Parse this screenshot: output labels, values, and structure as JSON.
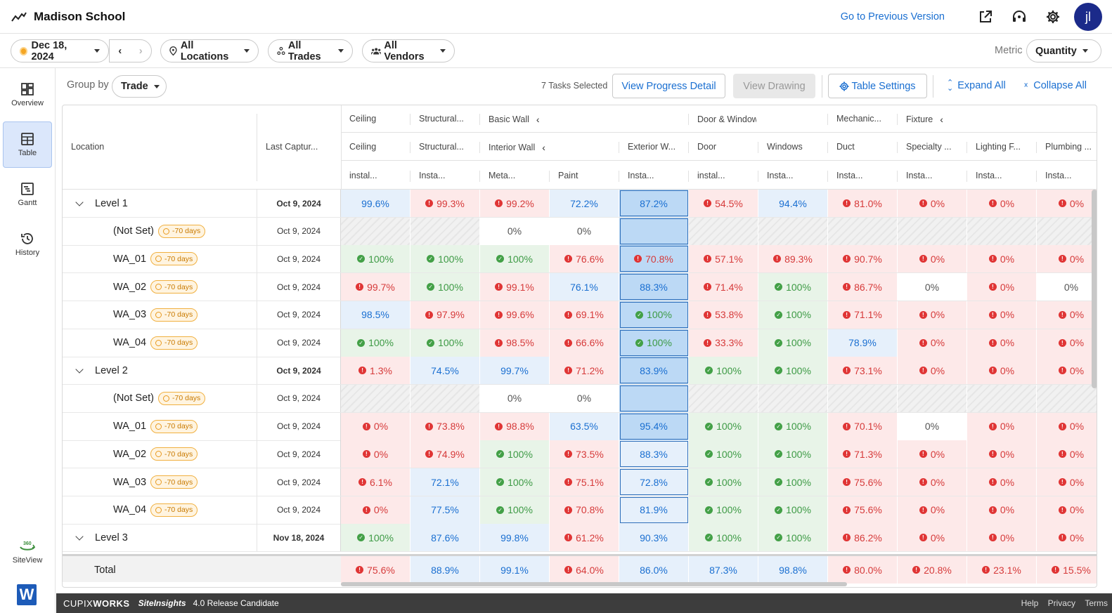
{
  "app": {
    "title": "Madison School",
    "prev_version": "Go to Previous Version",
    "avatar": "jl"
  },
  "filters": {
    "date": "Dec 18, 2024",
    "locations": "All Locations",
    "trades": "All Trades",
    "vendors": "All Vendors",
    "metric_label": "Metric",
    "metric_value": "Quantity"
  },
  "sidebar": {
    "items": [
      {
        "label": "Overview"
      },
      {
        "label": "Table"
      },
      {
        "label": "Gantt"
      },
      {
        "label": "History"
      }
    ],
    "siteview": "SiteView"
  },
  "toolbar": {
    "group_by_label": "Group by",
    "group_by_value": "Trade",
    "tasks_selected": "7 Tasks Selected",
    "view_progress": "View Progress Detail",
    "view_drawing": "View Drawing",
    "table_settings": "Table Settings",
    "expand_all": "Expand All",
    "collapse_all": "Collapse All"
  },
  "table": {
    "location_header": "Location",
    "last_capture_header": "Last Captur...",
    "groups": [
      "Ceiling",
      "Structural...",
      "Basic Wall",
      "Door & Window",
      "Mechanic...",
      "Fixture"
    ],
    "subgroups": [
      "Ceiling",
      "Structural...",
      "Interior Wall",
      "Exterior W...",
      "Door",
      "Windows",
      "Duct",
      "Specialty ...",
      "Lighting F...",
      "Plumbing ..."
    ],
    "tasks": [
      "instal...",
      "Insta...",
      "Meta...",
      "Paint",
      "Insta...",
      "instal...",
      "Insta...",
      "Insta...",
      "Insta...",
      "Insta...",
      "Insta..."
    ],
    "rows": [
      {
        "label": "Level 1",
        "level": 0,
        "date": "Oct 9, 2024",
        "cells": [
          [
            "99.6%",
            "b"
          ],
          [
            "99.3%",
            "r"
          ],
          [
            "99.2%",
            "r"
          ],
          [
            "72.2%",
            "b"
          ],
          [
            "87.2%",
            "s"
          ],
          [
            "54.5%",
            "r"
          ],
          [
            "94.4%",
            "b"
          ],
          [
            "81.0%",
            "r"
          ],
          [
            "0%",
            "r"
          ],
          [
            "0%",
            "r"
          ],
          [
            "0%",
            "r"
          ]
        ]
      },
      {
        "label": "(Not Set)",
        "level": 1,
        "badge": "-70 days",
        "date": "Oct 9, 2024",
        "cells": [
          [
            "",
            "h"
          ],
          [
            "",
            "h"
          ],
          [
            "0%",
            "w"
          ],
          [
            "0%",
            "w"
          ],
          [
            "",
            "hs"
          ],
          [
            "",
            "h"
          ],
          [
            "",
            "h"
          ],
          [
            "",
            "h"
          ],
          [
            "",
            "h"
          ],
          [
            "",
            "h"
          ],
          [
            "",
            "h"
          ]
        ]
      },
      {
        "label": "WA_01",
        "level": 1,
        "badge": "-70 days",
        "date": "Oct 9, 2024",
        "cells": [
          [
            "100%",
            "g"
          ],
          [
            "100%",
            "g"
          ],
          [
            "100%",
            "g"
          ],
          [
            "76.6%",
            "r"
          ],
          [
            "70.8%",
            "rs"
          ],
          [
            "57.1%",
            "r"
          ],
          [
            "89.3%",
            "r"
          ],
          [
            "90.7%",
            "r"
          ],
          [
            "0%",
            "r"
          ],
          [
            "0%",
            "r"
          ],
          [
            "0%",
            "r"
          ]
        ]
      },
      {
        "label": "WA_02",
        "level": 1,
        "badge": "-70 days",
        "date": "Oct 9, 2024",
        "cells": [
          [
            "99.7%",
            "r"
          ],
          [
            "100%",
            "g"
          ],
          [
            "99.1%",
            "r"
          ],
          [
            "76.1%",
            "b"
          ],
          [
            "88.3%",
            "s"
          ],
          [
            "71.4%",
            "r"
          ],
          [
            "100%",
            "g"
          ],
          [
            "86.7%",
            "r"
          ],
          [
            "0%",
            "w"
          ],
          [
            "0%",
            "r"
          ],
          [
            "0%",
            "w"
          ]
        ]
      },
      {
        "label": "WA_03",
        "level": 1,
        "badge": "-70 days",
        "date": "Oct 9, 2024",
        "cells": [
          [
            "98.5%",
            "b"
          ],
          [
            "97.9%",
            "r"
          ],
          [
            "99.6%",
            "r"
          ],
          [
            "69.1%",
            "r"
          ],
          [
            "100%",
            "gs"
          ],
          [
            "53.8%",
            "r"
          ],
          [
            "100%",
            "g"
          ],
          [
            "71.1%",
            "r"
          ],
          [
            "0%",
            "r"
          ],
          [
            "0%",
            "r"
          ],
          [
            "0%",
            "r"
          ]
        ]
      },
      {
        "label": "WA_04",
        "level": 1,
        "badge": "-70 days",
        "date": "Oct 9, 2024",
        "cells": [
          [
            "100%",
            "g"
          ],
          [
            "100%",
            "g"
          ],
          [
            "98.5%",
            "r"
          ],
          [
            "66.6%",
            "r"
          ],
          [
            "100%",
            "gs"
          ],
          [
            "33.3%",
            "r"
          ],
          [
            "100%",
            "g"
          ],
          [
            "78.9%",
            "b"
          ],
          [
            "0%",
            "r"
          ],
          [
            "0%",
            "r"
          ],
          [
            "0%",
            "r"
          ]
        ]
      },
      {
        "label": "Level 2",
        "level": 0,
        "date": "Oct 9, 2024",
        "cells": [
          [
            "1.3%",
            "r"
          ],
          [
            "74.5%",
            "b"
          ],
          [
            "99.7%",
            "b"
          ],
          [
            "71.2%",
            "r"
          ],
          [
            "83.9%",
            "s"
          ],
          [
            "100%",
            "g"
          ],
          [
            "100%",
            "g"
          ],
          [
            "73.1%",
            "r"
          ],
          [
            "0%",
            "r"
          ],
          [
            "0%",
            "r"
          ],
          [
            "0%",
            "r"
          ]
        ]
      },
      {
        "label": "(Not Set)",
        "level": 1,
        "badge": "-70 days",
        "date": "Oct 9, 2024",
        "cells": [
          [
            "",
            "h"
          ],
          [
            "",
            "h"
          ],
          [
            "0%",
            "w"
          ],
          [
            "0%",
            "w"
          ],
          [
            "",
            "hs"
          ],
          [
            "",
            "h"
          ],
          [
            "",
            "h"
          ],
          [
            "",
            "h"
          ],
          [
            "",
            "h"
          ],
          [
            "",
            "h"
          ],
          [
            "",
            "h"
          ]
        ]
      },
      {
        "label": "WA_01",
        "level": 1,
        "badge": "-70 days",
        "date": "Oct 9, 2024",
        "cells": [
          [
            "0%",
            "r"
          ],
          [
            "73.8%",
            "r"
          ],
          [
            "98.8%",
            "r"
          ],
          [
            "63.5%",
            "b"
          ],
          [
            "95.4%",
            "s"
          ],
          [
            "100%",
            "g"
          ],
          [
            "100%",
            "g"
          ],
          [
            "70.1%",
            "r"
          ],
          [
            "0%",
            "w"
          ],
          [
            "0%",
            "r"
          ],
          [
            "0%",
            "r"
          ]
        ]
      },
      {
        "label": "WA_02",
        "level": 1,
        "badge": "-70 days",
        "date": "Oct 9, 2024",
        "cells": [
          [
            "0%",
            "r"
          ],
          [
            "74.9%",
            "r"
          ],
          [
            "100%",
            "g"
          ],
          [
            "73.5%",
            "r"
          ],
          [
            "88.3%",
            "bo"
          ],
          [
            "100%",
            "g"
          ],
          [
            "100%",
            "g"
          ],
          [
            "71.3%",
            "r"
          ],
          [
            "0%",
            "r"
          ],
          [
            "0%",
            "r"
          ],
          [
            "0%",
            "r"
          ]
        ]
      },
      {
        "label": "WA_03",
        "level": 1,
        "badge": "-70 days",
        "date": "Oct 9, 2024",
        "cells": [
          [
            "6.1%",
            "r"
          ],
          [
            "72.1%",
            "b"
          ],
          [
            "100%",
            "g"
          ],
          [
            "75.1%",
            "r"
          ],
          [
            "72.8%",
            "bo"
          ],
          [
            "100%",
            "g"
          ],
          [
            "100%",
            "g"
          ],
          [
            "75.6%",
            "r"
          ],
          [
            "0%",
            "r"
          ],
          [
            "0%",
            "r"
          ],
          [
            "0%",
            "r"
          ]
        ]
      },
      {
        "label": "WA_04",
        "level": 1,
        "badge": "-70 days",
        "date": "Oct 9, 2024",
        "cells": [
          [
            "0%",
            "r"
          ],
          [
            "77.5%",
            "b"
          ],
          [
            "100%",
            "g"
          ],
          [
            "70.8%",
            "r"
          ],
          [
            "81.9%",
            "bo"
          ],
          [
            "100%",
            "g"
          ],
          [
            "100%",
            "g"
          ],
          [
            "75.6%",
            "r"
          ],
          [
            "0%",
            "r"
          ],
          [
            "0%",
            "r"
          ],
          [
            "0%",
            "r"
          ]
        ]
      },
      {
        "label": "Level 3",
        "level": 0,
        "date": "Nov 18, 2024",
        "cells": [
          [
            "100%",
            "g"
          ],
          [
            "87.6%",
            "b"
          ],
          [
            "99.8%",
            "b"
          ],
          [
            "61.2%",
            "r"
          ],
          [
            "90.3%",
            "b"
          ],
          [
            "100%",
            "g"
          ],
          [
            "100%",
            "g"
          ],
          [
            "86.2%",
            "r"
          ],
          [
            "0%",
            "r"
          ],
          [
            "0%",
            "r"
          ],
          [
            "0%",
            "r"
          ]
        ]
      }
    ],
    "total": {
      "label": "Total",
      "cells": [
        [
          "75.6%",
          "r"
        ],
        [
          "88.9%",
          "b"
        ],
        [
          "99.1%",
          "b"
        ],
        [
          "64.0%",
          "r"
        ],
        [
          "86.0%",
          "b"
        ],
        [
          "87.3%",
          "b"
        ],
        [
          "98.8%",
          "b"
        ],
        [
          "80.0%",
          "r"
        ],
        [
          "20.8%",
          "r"
        ],
        [
          "23.1%",
          "r"
        ],
        [
          "15.5%",
          "r"
        ]
      ]
    }
  },
  "footer": {
    "brand_light": "CUPIX",
    "brand_bold": "WORKS",
    "product": "SiteInsights",
    "version": "4.0 Release Candidate",
    "links": [
      "Help",
      "Privacy",
      "Terms"
    ]
  }
}
